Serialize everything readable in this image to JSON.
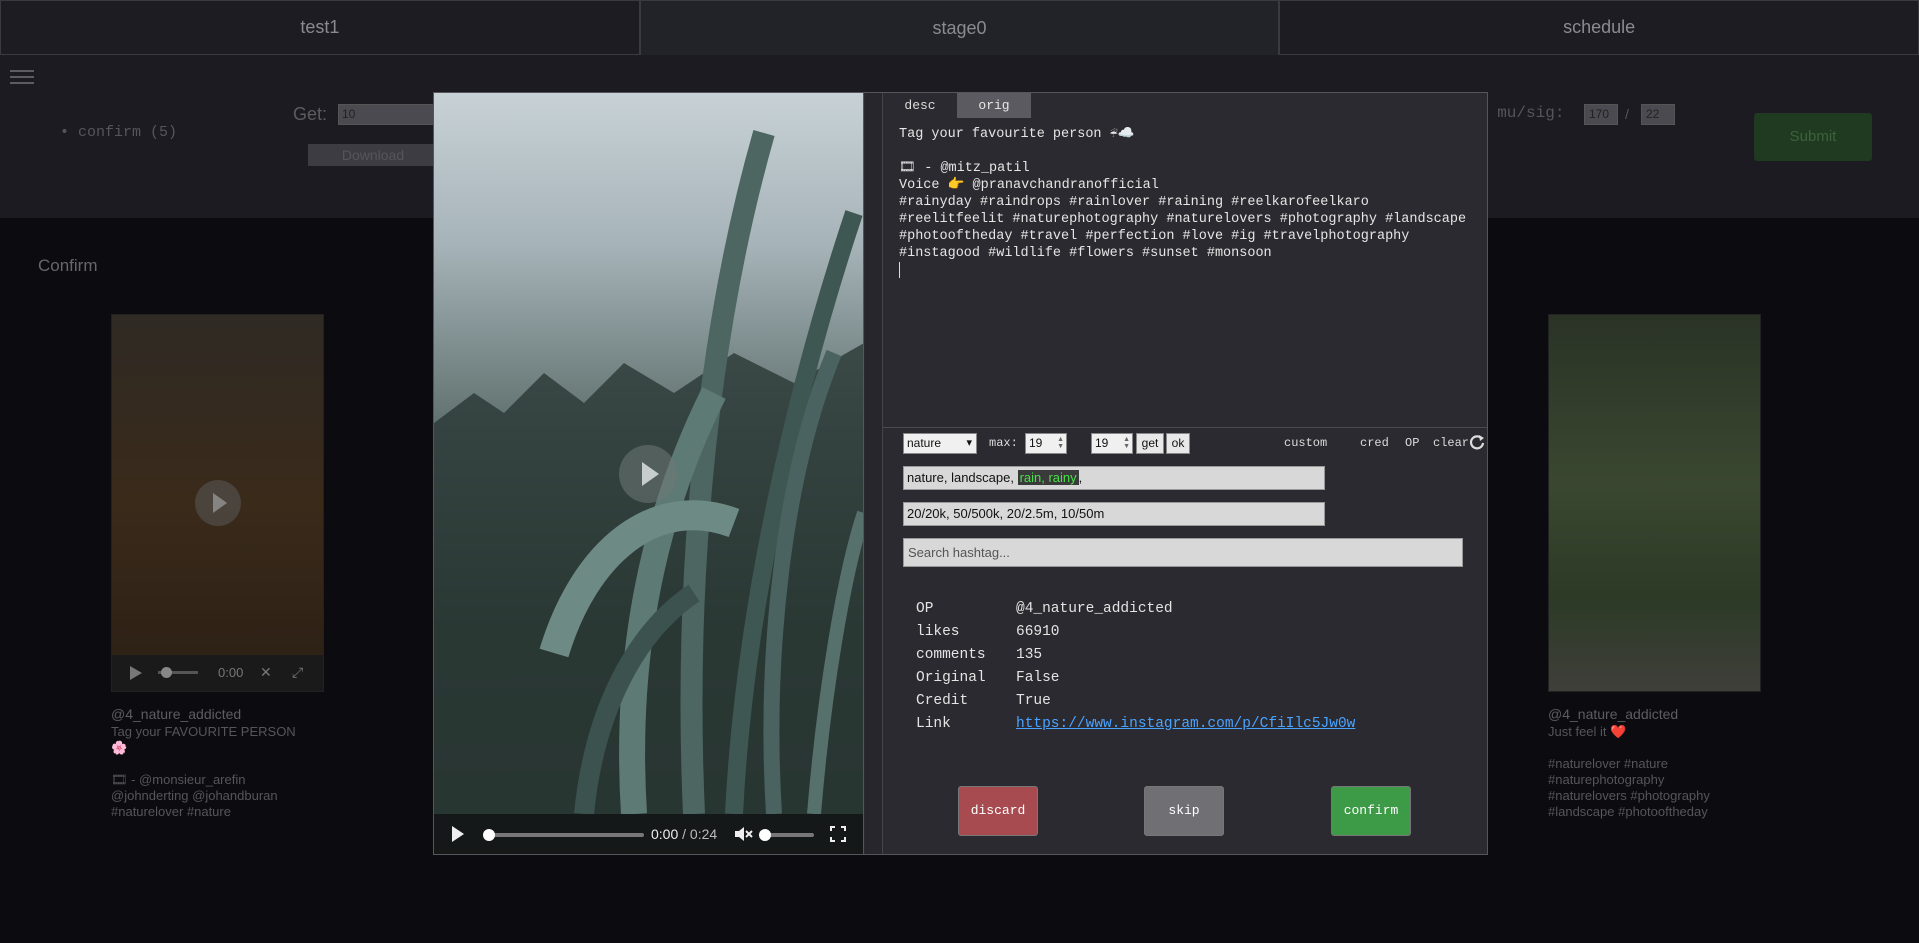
{
  "tabs": [
    "test1",
    "stage0",
    "schedule"
  ],
  "sidebar": {
    "confirm_item": "confirm (5)"
  },
  "controls": {
    "get_label": "Get:",
    "get_value": "10",
    "download_label": "Download",
    "musig_label": "k mu/sig:",
    "mu_value": "170",
    "slash": "/",
    "sig_value": "22",
    "submit_label": "Submit"
  },
  "section_title": "Confirm",
  "cards": [
    {
      "handle": "@4_nature_addicted",
      "caption": "Tag your FAVOURITE PERSON\n🌸\n\n🎞 - @monsieur_arefin\n@johnderting @johandburan\n#naturelover #nature",
      "time": "0:00"
    },
    {
      "handle": "@4_nature_addicted",
      "caption": "Just feel it ❤️\n\n#naturelover #nature\n#naturephotography\n#naturelovers #photography\n#landscape #photooftheday"
    }
  ],
  "modal": {
    "video": {
      "current": "0:00",
      "duration": "0:24",
      "progress": 0.0
    },
    "desc_tabs": [
      "desc",
      "orig"
    ],
    "description": "Tag your favourite person ☔☁️\n\n🎞 - @mitz_patil\nVoice 👉 @pranavchandranofficial\n#rainyday #raindrops #rainlover #raining #reelkarofeelkaro\n#reelitfeelit #naturephotography #naturelovers #photography #landscape\n#photooftheday #travel #perfection #love #ig #travelphotography\n#instagood #wildlife #flowers #sunset #monsoon\n",
    "category": "nature",
    "max_label": "max:",
    "max_value": "19",
    "second_value": "19",
    "get_label": "get",
    "ok_label": "ok",
    "tools": [
      "custom",
      "cred",
      "OP",
      "clear"
    ],
    "tags_prefix": "nature, landscape, ",
    "tags_highlight": "rain, rainy",
    "tags_suffix": ",",
    "ranges": "20/20k, 50/500k, 20/2.5m, 10/50m",
    "search_placeholder": "Search hashtag...",
    "info": {
      "op_k": "OP",
      "op_v": "@4_nature_addicted",
      "likes_k": "likes",
      "likes_v": "66910",
      "comments_k": "comments",
      "comments_v": "135",
      "original_k": "Original",
      "original_v": "False",
      "credit_k": "Credit",
      "credit_v": "True",
      "link_k": "Link",
      "link_v": "https://www.instagram.com/p/CfiIlc5Jw0w"
    },
    "buttons": {
      "discard": "discard",
      "skip": "skip",
      "confirm": "confirm"
    },
    "colors": {
      "discard": "#a84b50",
      "skip": "#707074",
      "confirm": "#3d9a46"
    }
  }
}
